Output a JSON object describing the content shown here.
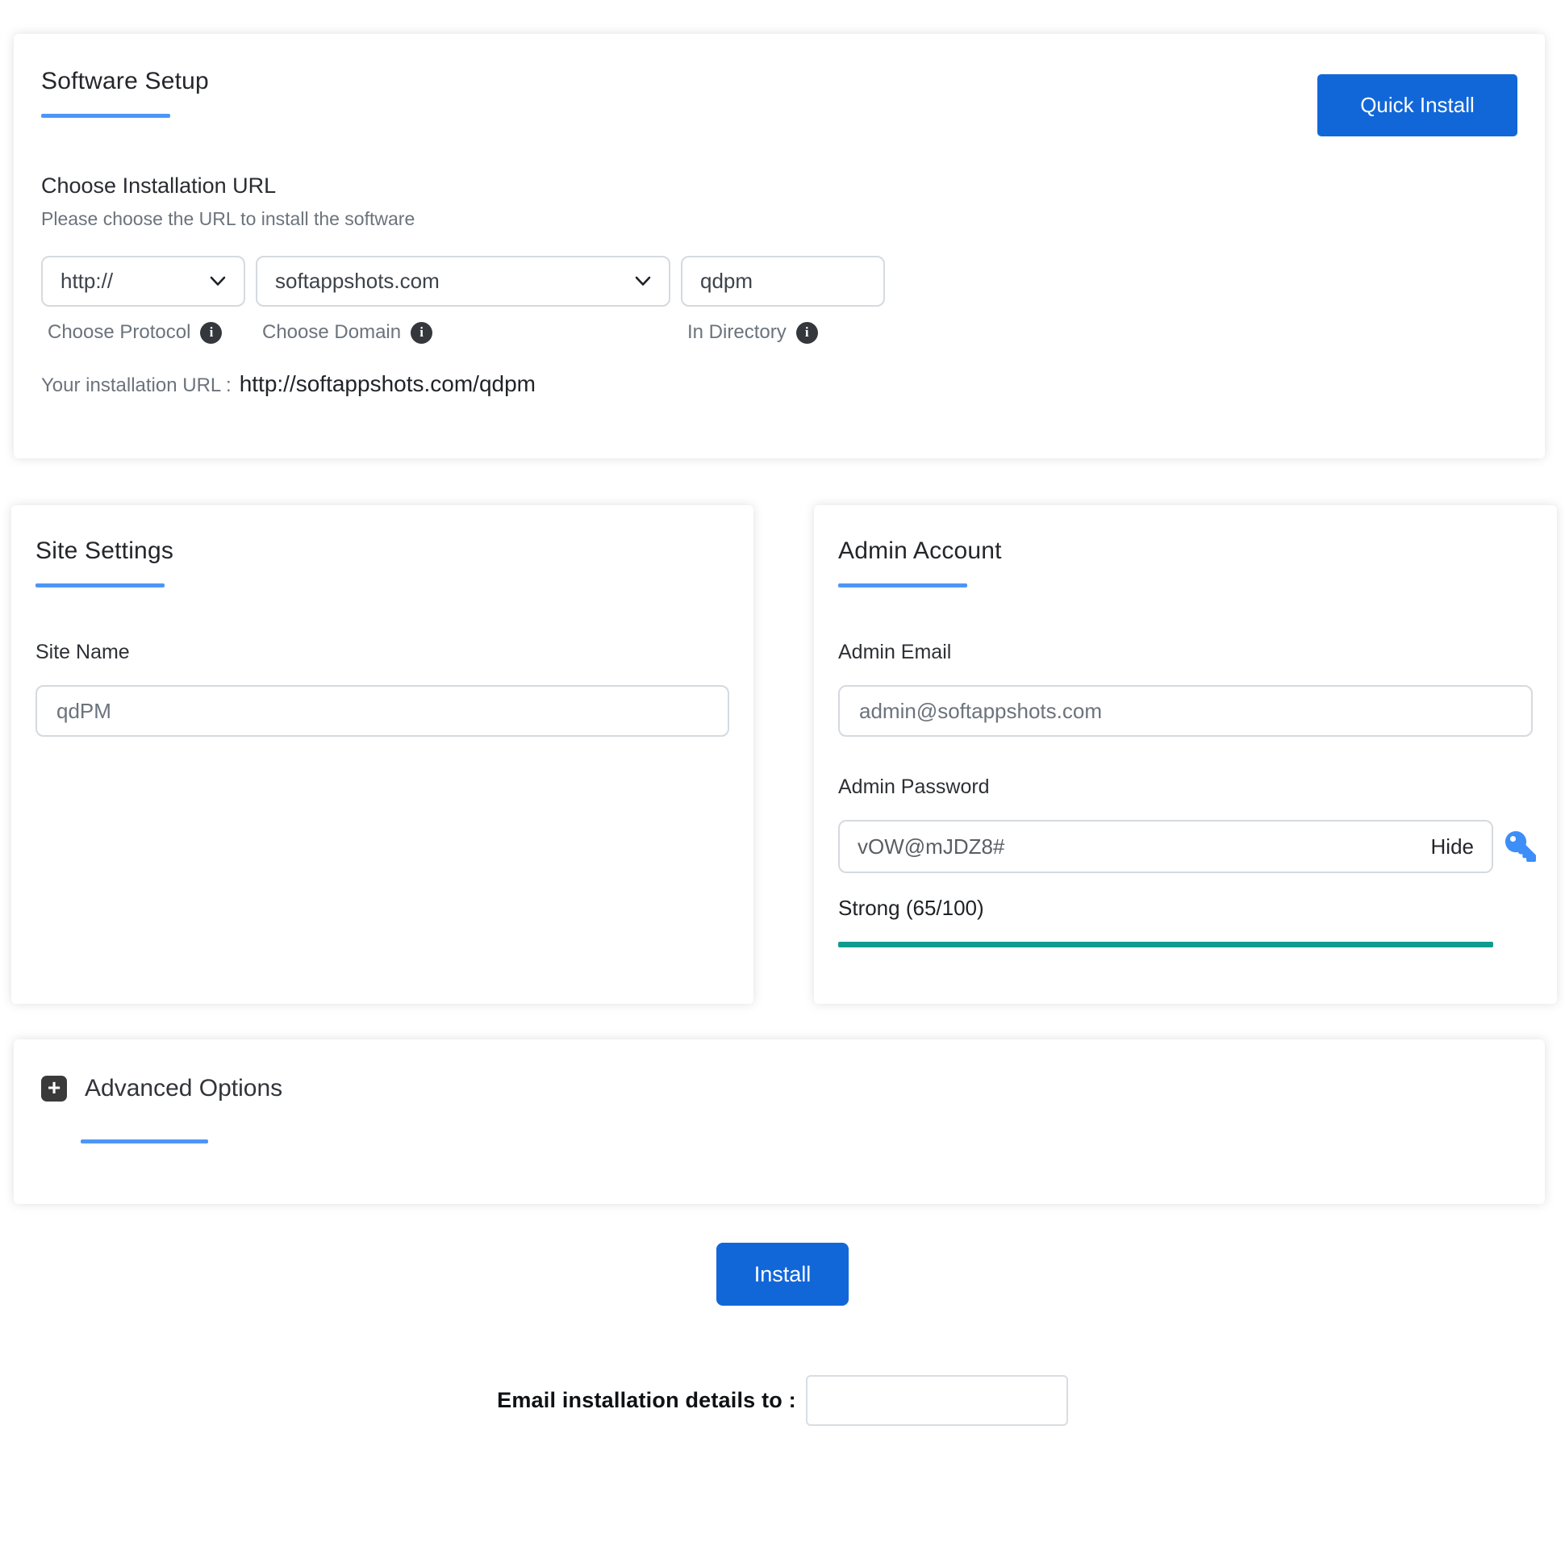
{
  "colors": {
    "primary_blue": "#1267d8",
    "heading_underline_blue": "#4d96f7",
    "strength_bar_teal": "#0f9b8e"
  },
  "icons": {
    "info_glyph": "i",
    "plus_glyph": "+"
  },
  "software_setup": {
    "title": "Software Setup",
    "quick_install_button": "Quick Install",
    "choose_url_heading": "Choose Installation URL",
    "choose_url_subtitle": "Please choose the URL to install the software",
    "protocol": {
      "value": "http://",
      "label": "Choose Protocol"
    },
    "domain": {
      "value": "softappshots.com",
      "label": "Choose Domain"
    },
    "directory": {
      "value": "qdpm",
      "label": "In Directory"
    },
    "installation_url_label": "Your installation URL :",
    "installation_url_value": "http://softappshots.com/qdpm"
  },
  "site_settings": {
    "title": "Site Settings",
    "site_name_label": "Site Name",
    "site_name_value": "qdPM"
  },
  "admin_account": {
    "title": "Admin Account",
    "admin_email_label": "Admin Email",
    "admin_email_value": "admin@softappshots.com",
    "admin_password_label": "Admin Password",
    "admin_password_value": "vOW@mJDZ8#",
    "hide_toggle_label": "Hide",
    "strength_text": "Strong (65/100)",
    "strength_fill_percent": 100
  },
  "advanced_options": {
    "title": "Advanced Options"
  },
  "footer": {
    "install_button": "Install",
    "email_details_label": "Email installation details to :",
    "email_details_value": ""
  }
}
